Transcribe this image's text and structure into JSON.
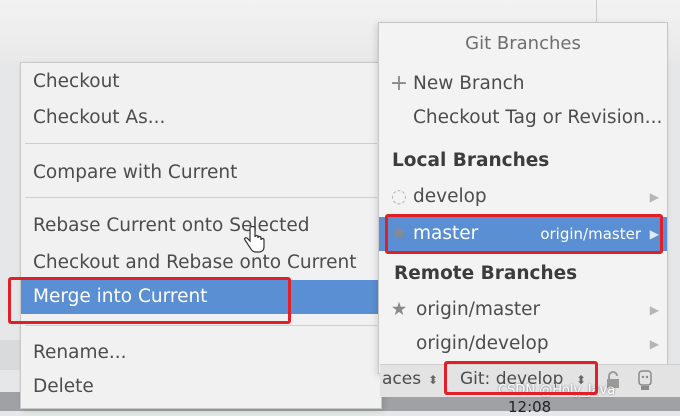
{
  "context_menu": {
    "items": [
      {
        "label": "Checkout"
      },
      {
        "label": "Checkout As..."
      },
      {
        "label": "Compare with Current"
      },
      {
        "label": "Rebase Current onto Selected"
      },
      {
        "label": "Checkout and Rebase onto Current"
      },
      {
        "label": "Merge into Current",
        "selected": true
      },
      {
        "label": "Rename..."
      },
      {
        "label": "Delete"
      }
    ]
  },
  "git_branches": {
    "title": "Git Branches",
    "new_branch_label": "New Branch",
    "checkout_tag_label": "Checkout Tag or Revision...",
    "local_header": "Local Branches",
    "local": [
      {
        "name": "develop",
        "tracking": "",
        "icon": "tag-icon"
      },
      {
        "name": "master",
        "tracking": "origin/master",
        "icon": "star-icon",
        "selected": true
      }
    ],
    "remote_header": "Remote Branches",
    "remote": [
      {
        "name": "origin/master",
        "icon": "star-icon"
      },
      {
        "name": "origin/develop",
        "icon": ""
      }
    ]
  },
  "status_bar": {
    "left_fragment": "aces",
    "git_widget": "Git: develop"
  },
  "clock": "12:08",
  "watermark": "CSDN @Holy_Java",
  "colors": {
    "selection": "#5a8fd3",
    "annotation": "#e21f26"
  }
}
